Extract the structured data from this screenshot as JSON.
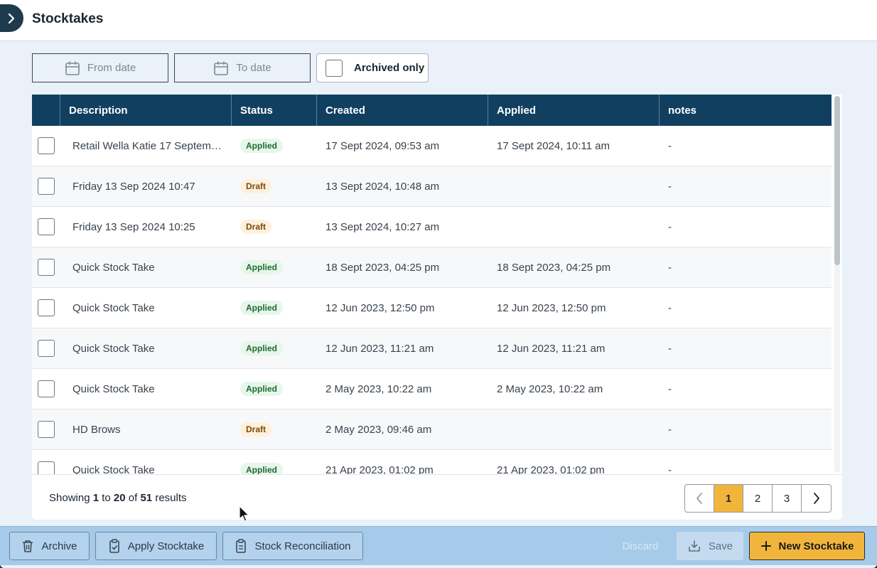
{
  "header": {
    "title": "Stocktakes"
  },
  "filters": {
    "from_date": "From date",
    "to_date": "To date",
    "archived_only": "Archived only"
  },
  "table": {
    "columns": [
      "Description",
      "Status",
      "Created",
      "Applied",
      "notes"
    ],
    "rows": [
      {
        "description": "Retail Wella Katie 17 Septemb...",
        "status": "Applied",
        "created": "17 Sept 2024, 09:53 am",
        "applied": "17 Sept 2024, 10:11 am",
        "notes": "-"
      },
      {
        "description": "Friday 13 Sep 2024 10:47",
        "status": "Draft",
        "created": "13 Sept 2024, 10:48 am",
        "applied": "",
        "notes": "-"
      },
      {
        "description": "Friday 13 Sep 2024 10:25",
        "status": "Draft",
        "created": "13 Sept 2024, 10:27 am",
        "applied": "",
        "notes": "-"
      },
      {
        "description": "Quick Stock Take",
        "status": "Applied",
        "created": "18 Sept 2023, 04:25 pm",
        "applied": "18 Sept 2023, 04:25 pm",
        "notes": "-"
      },
      {
        "description": "Quick Stock Take",
        "status": "Applied",
        "created": "12 Jun 2023, 12:50 pm",
        "applied": "12 Jun 2023, 12:50 pm",
        "notes": "-"
      },
      {
        "description": "Quick Stock Take",
        "status": "Applied",
        "created": "12 Jun 2023, 11:21 am",
        "applied": "12 Jun 2023, 11:21 am",
        "notes": "-"
      },
      {
        "description": "Quick Stock Take",
        "status": "Applied",
        "created": "2 May 2023, 10:22 am",
        "applied": "2 May 2023, 10:22 am",
        "notes": "-"
      },
      {
        "description": "HD Brows",
        "status": "Draft",
        "created": "2 May 2023, 09:46 am",
        "applied": "",
        "notes": "-"
      },
      {
        "description": "Quick Stock Take",
        "status": "Applied",
        "created": "21 Apr 2023, 01:02 pm",
        "applied": "21 Apr 2023, 01:02 pm",
        "notes": "-"
      }
    ]
  },
  "results": {
    "prefix": "Showing",
    "from": "1",
    "to_word": "to",
    "to": "20",
    "of_word": "of",
    "total": "51",
    "suffix": "results"
  },
  "pagination": {
    "prev": "‹",
    "pages": [
      "1",
      "2",
      "3"
    ],
    "next": "›",
    "active": "1"
  },
  "actions": {
    "archive": "Archive",
    "apply": "Apply Stocktake",
    "reconciliation": "Stock Reconciliation",
    "discard": "Discard",
    "save": "Save",
    "new": "New Stocktake"
  },
  "colors": {
    "header_bg": "#113f60",
    "accent": "#f2b53c",
    "action_bar": "#a6cae9",
    "applied_text": "#1f6b32",
    "draft_text": "#7a4a07"
  }
}
